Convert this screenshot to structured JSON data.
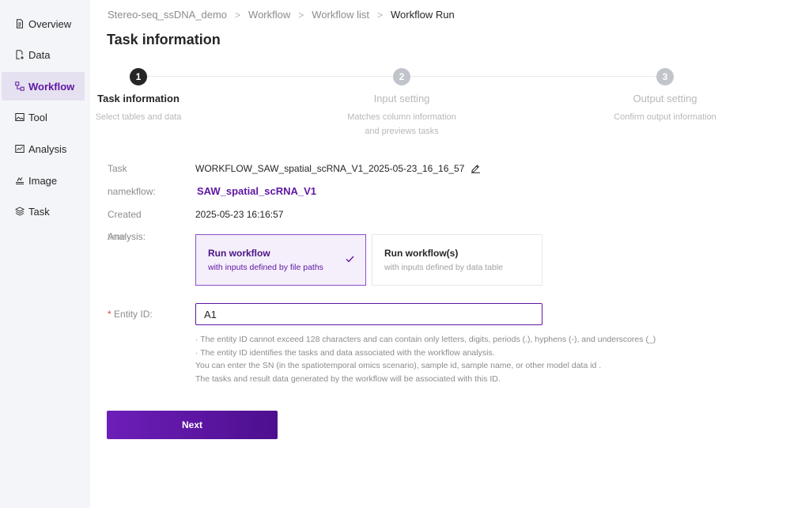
{
  "sidebar": {
    "items": [
      {
        "label": "Overview",
        "icon": "document-icon"
      },
      {
        "label": "Data",
        "icon": "data-file-icon"
      },
      {
        "label": "Workflow",
        "icon": "workflow-icon",
        "active": true
      },
      {
        "label": "Tool",
        "icon": "tool-image-icon"
      },
      {
        "label": "Analysis",
        "icon": "analysis-chart-icon"
      },
      {
        "label": "Image",
        "icon": "image-stack-icon"
      },
      {
        "label": "Task",
        "icon": "layers-icon"
      }
    ]
  },
  "breadcrumb": {
    "items": [
      "Stereo-seq_ssDNA_demo",
      "Workflow",
      "Workflow list",
      "Workflow Run"
    ],
    "separator": ">"
  },
  "page_title": "Task information",
  "steps": [
    {
      "number": "1",
      "title": "Task information",
      "desc": "Select tables and data",
      "desc2": ""
    },
    {
      "number": "2",
      "title": "Input setting",
      "desc": "Matches column information",
      "desc2": "and previews tasks"
    },
    {
      "number": "3",
      "title": "Output setting",
      "desc": "Confirm output information",
      "desc2": ""
    }
  ],
  "form": {
    "task_label": "Task",
    "task_value": "WORKFLOW_SAW_spatial_scRNA_V1_2025-05-23_16_16_57",
    "workflow_label": "namekflow:",
    "workflow_value": "SAW_spatial_scRNA_V1",
    "created_label": "Created",
    "created_value": "2025-05-23 16:16:57",
    "analysis_label": "Analysis:",
    "analysis_overlap": "time",
    "run_options": [
      {
        "title": "Run workflow",
        "sub": "with inputs defined by file paths",
        "selected": true
      },
      {
        "title": "Run workflow(s)",
        "sub": "with inputs defined by data table",
        "selected": false
      }
    ],
    "entity_required": "*",
    "entity_label": "Entity  ID:",
    "entity_value": "A1",
    "hints": [
      "· The entity ID cannot exceed 128 characters and can contain only letters, digits, periods (.), hyphens (-), and underscores (_)",
      "· The entity ID identifies the tasks and data associated with the workflow analysis.",
      "You can enter the SN (in the spatiotemporal omics scenario), sample id, sample name, or other model data id .",
      "The tasks and result data generated by the workflow will be associated with this ID."
    ]
  },
  "next_button": "Next",
  "colors": {
    "accent": "#5e17a3",
    "sidebar_bg": "#f4f5f9",
    "active_nav_bg": "#e6e1f0",
    "required": "#e03e3e"
  }
}
